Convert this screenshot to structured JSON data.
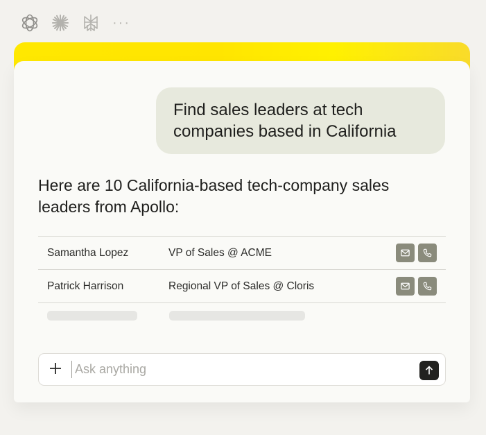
{
  "app_icons": [
    {
      "name": "openai-logo-icon"
    },
    {
      "name": "claude-logo-icon"
    },
    {
      "name": "perplexity-logo-icon"
    },
    {
      "name": "more-dots-icon",
      "text": "···"
    }
  ],
  "chat": {
    "user_message": "Find sales leaders at tech companies based in California",
    "assistant_reply": "Here are 10 California-based tech-company sales leaders from Apollo:"
  },
  "results": [
    {
      "name": "Samantha Lopez",
      "title": "VP of Sales @ ACME"
    },
    {
      "name": "Patrick Harrison",
      "title": "Regional VP of Sales @ Cloris"
    }
  ],
  "composer": {
    "placeholder": "Ask anything"
  },
  "colors": {
    "accent_yellow": "#ffe800",
    "bubble_bg": "#e7e9dd",
    "action_btn": "#8a8b7c",
    "send_btn": "#222220"
  }
}
